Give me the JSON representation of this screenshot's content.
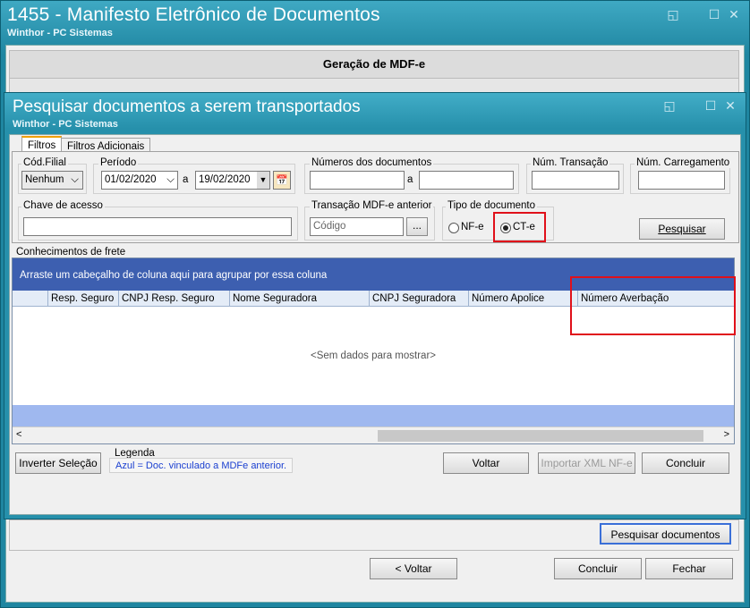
{
  "main_window": {
    "title": "1455 - Manifesto Eletrônico de Documentos",
    "subtitle": "Winthor - PC Sistemas",
    "section_title": "Geração de MDF-e",
    "buttons": {
      "search_documents": "Pesquisar documentos",
      "back": "< Voltar",
      "finish": "Concluir",
      "close": "Fechar"
    }
  },
  "dialog": {
    "title": "Pesquisar documentos a serem transportados",
    "subtitle": "Winthor - PC Sistemas",
    "tabs": [
      "Filtros",
      "Filtros Adicionais"
    ],
    "filters": {
      "cod_filial_label": "Cód.Filial",
      "cod_filial_value": "Nenhum",
      "periodo_label": "Período",
      "date_from": "01/02/2020",
      "date_sep": "a",
      "date_to": "19/02/2020",
      "numeros_label": "Números dos documentos",
      "numeros_sep": "a",
      "num_transacao_label": "Núm. Transação",
      "num_carregamento_label": "Núm. Carregamento",
      "chave_label": "Chave de acesso",
      "transacao_mdfe_label": "Transação MDF-e anterior",
      "transacao_mdfe_placeholder": "Código",
      "ellipsis": "...",
      "tipo_doc_label": "Tipo de documento",
      "radio_nfe": "NF-e",
      "radio_cte": "CT-e",
      "selected_tipo": "CT-e",
      "search_button": "Pesquisar"
    },
    "grid": {
      "section_label": "Conhecimentos de frete",
      "group_hint": "Arraste um cabeçalho de coluna aqui para agrupar por essa coluna",
      "columns": [
        "Resp. Seguro",
        "CNPJ Resp. Seguro",
        "Nome Seguradora",
        "CNPJ Seguradora",
        "Número Apolice",
        "Número Averbação"
      ],
      "empty_text": "<Sem dados para mostrar>"
    },
    "bottom": {
      "invert_selection": "Inverter Seleção",
      "legend_title": "Legenda",
      "legend_text": "Azul = Doc. vinculado a MDFe anterior.",
      "back": "Voltar",
      "import_xml": "Importar XML NF-e",
      "finish": "Concluir"
    }
  },
  "colors": {
    "title_bar": "#2690ab",
    "grid_group": "#3d5fb0",
    "highlight": "#e0101a",
    "legend_text": "#1a3fd0"
  }
}
